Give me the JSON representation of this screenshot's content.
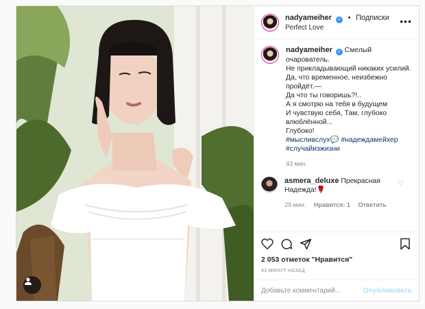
{
  "post": {
    "author": {
      "username": "nadyameiher",
      "follow_label": "Подписки",
      "location": "Perfect Love",
      "more_icon": "more-icon"
    },
    "caption": {
      "username": "nadyameiher",
      "lines": [
        "Смелый очарователь.",
        "Не прикладывающий никаких усилий.",
        "Да, что временное, неизбежно пройдёт.—",
        "Да что ты говоришь?!..",
        "А я смотрю на тебя в будущем",
        "И чувствую себя, Там, глубоко влюблённой...",
        "Глубоко!"
      ],
      "hashtags_line1": "#мысливслух💬 #надеждамейхер",
      "hashtags_line2": "#случайизжизни",
      "time": "43 мин."
    },
    "comment": {
      "username": "asmera_deluxe",
      "text": "Прекрасная Надежда!🌹",
      "time": "29 мин.",
      "likes": "Нравится: 1",
      "reply": "Ответить"
    },
    "likes_text": "2 053 отметок \"Нравится\"",
    "posted_ago": "43 МИНУТ НАЗАД",
    "comment_input": {
      "placeholder": "Добавьте комментарий...",
      "value": ""
    },
    "publish_label": "Опубликовать",
    "icons": [
      "heart-icon",
      "comment-icon",
      "share-icon",
      "bookmark-icon",
      "tag-user-icon"
    ]
  },
  "colors": {
    "link": "#00376b",
    "verified": "#3897f0",
    "publish_disabled": "#b2dffc",
    "muted": "#8e8e8e"
  }
}
